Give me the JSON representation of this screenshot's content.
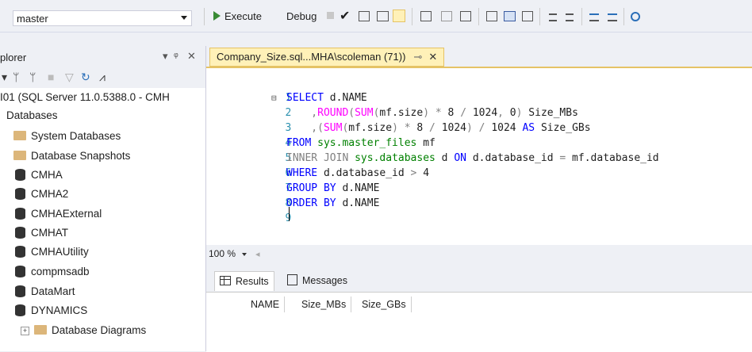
{
  "toolbar": {
    "database": "master",
    "execute_label": "Execute",
    "debug_label": "Debug"
  },
  "explorer": {
    "title": "plorer",
    "pin_glyph": "▾ ᵠ ✕",
    "server_node": "I01 (SQL Server 11.0.5388.0 - CMH",
    "databases_label": "Databases",
    "items": [
      {
        "label": "System Databases",
        "icon": "folder-icon"
      },
      {
        "label": "Database Snapshots",
        "icon": "folder-icon"
      },
      {
        "label": "CMHA",
        "icon": "database-icon"
      },
      {
        "label": "CMHA2",
        "icon": "database-icon"
      },
      {
        "label": "CMHAExternal",
        "icon": "database-icon"
      },
      {
        "label": "CMHAT",
        "icon": "database-icon"
      },
      {
        "label": "CMHAUtility",
        "icon": "database-icon"
      },
      {
        "label": "compmsadb",
        "icon": "database-icon"
      },
      {
        "label": "DataMart",
        "icon": "database-icon"
      },
      {
        "label": "DYNAMICS",
        "icon": "database-icon"
      }
    ],
    "sub_item": "Database Diagrams"
  },
  "editor": {
    "tab_title": "Company_Size.sql...MHA\\scoleman (71))",
    "line_numbers": [
      "1",
      "2",
      "3",
      "4",
      "5",
      "6",
      "7",
      "8",
      "9"
    ]
  },
  "zoom": "100 %",
  "results": {
    "tabs": [
      "Results",
      "Messages"
    ],
    "columns": [
      "NAME",
      "Size_MBs",
      "Size_GBs"
    ]
  },
  "colors": {
    "accent_tab": "#fff1b8",
    "keyword": "#0000ff",
    "function": "#ff00ff",
    "system_object": "#008000",
    "line_number": "#2b91af"
  }
}
